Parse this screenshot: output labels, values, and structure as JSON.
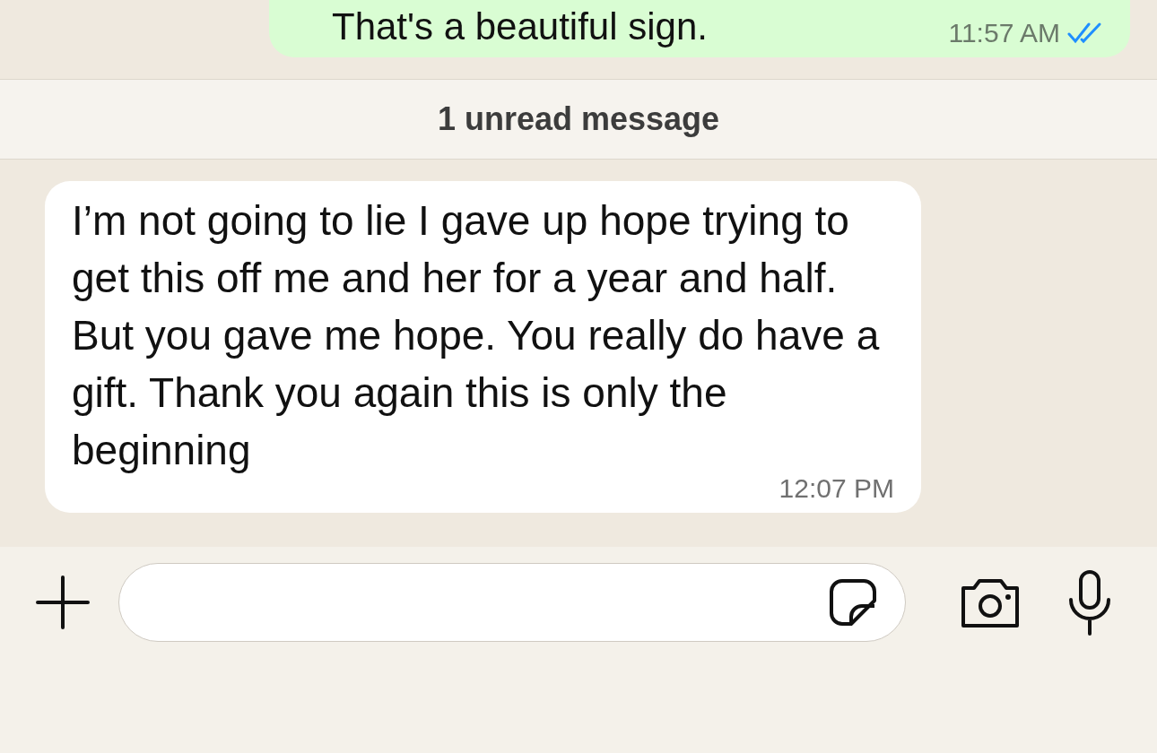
{
  "messages": [
    {
      "kind": "outgoing",
      "text": "That's a beautiful sign.",
      "time": "11:57 AM",
      "read": true
    },
    {
      "kind": "unread_divider",
      "text": "1 unread message"
    },
    {
      "kind": "incoming",
      "text": "I’m not going to lie I gave up hope trying to get this off me and her for a year and half. But you gave me hope. You really do have a gift. Thank you again this is only the beginning",
      "time": "12:07 PM"
    }
  ]
}
